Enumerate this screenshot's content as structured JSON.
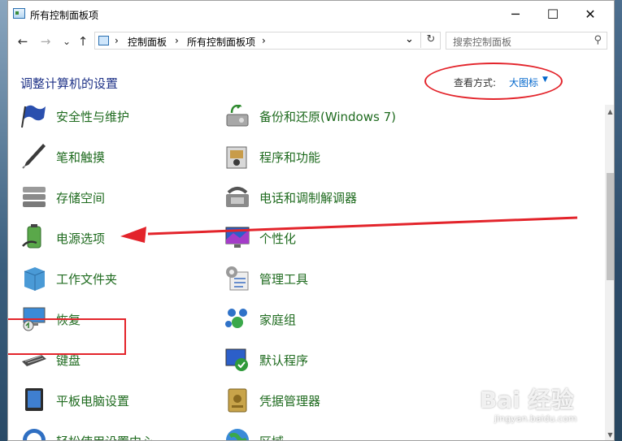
{
  "window": {
    "title": "所有控制面板项",
    "minimize": "─",
    "maximize": "☐",
    "close": "✕"
  },
  "nav": {
    "back": "←",
    "forward": "→",
    "recent": "⌄",
    "up": "↑",
    "breadcrumb": [
      "控制面板",
      "所有控制面板项"
    ],
    "sep": "›",
    "refresh": "↻",
    "dropdown": "⌄"
  },
  "search": {
    "placeholder": "搜索控制面板",
    "icon": "search-icon"
  },
  "page": {
    "heading": "调整计算机的设置",
    "viewby_label": "查看方式:",
    "viewby_value": "大图标",
    "viewby_arrow": "▼"
  },
  "items": {
    "col1": [
      {
        "label": "安全性与维护",
        "icon": "security-flag-icon"
      },
      {
        "label": "笔和触摸",
        "icon": "pen-icon"
      },
      {
        "label": "存储空间",
        "icon": "storage-icon"
      },
      {
        "label": "电源选项",
        "icon": "power-options-icon"
      },
      {
        "label": "工作文件夹",
        "icon": "work-folders-icon"
      },
      {
        "label": "恢复",
        "icon": "recovery-icon"
      },
      {
        "label": "键盘",
        "icon": "keyboard-icon"
      },
      {
        "label": "平板电脑设置",
        "icon": "tablet-icon"
      },
      {
        "label": "轻松使用设置中心",
        "icon": "ease-of-access-icon"
      }
    ],
    "col2": [
      {
        "label": "备份和还原(Windows 7)",
        "icon": "backup-icon"
      },
      {
        "label": "程序和功能",
        "icon": "programs-icon"
      },
      {
        "label": "电话和调制解调器",
        "icon": "phone-modem-icon"
      },
      {
        "label": "个性化",
        "icon": "personalization-icon"
      },
      {
        "label": "管理工具",
        "icon": "admin-tools-icon"
      },
      {
        "label": "家庭组",
        "icon": "homegroup-icon"
      },
      {
        "label": "默认程序",
        "icon": "default-programs-icon"
      },
      {
        "label": "凭据管理器",
        "icon": "credential-manager-icon"
      },
      {
        "label": "区域",
        "icon": "region-icon"
      }
    ]
  },
  "scrollbar": {
    "up": "▲",
    "down": "▼"
  },
  "watermark": {
    "main": "Bai 经验",
    "sub": "jingyan.baidu.com"
  },
  "colors": {
    "link_green": "#1f6b1f",
    "heading_blue": "#1e3287",
    "annotation_red": "#e3242b"
  }
}
